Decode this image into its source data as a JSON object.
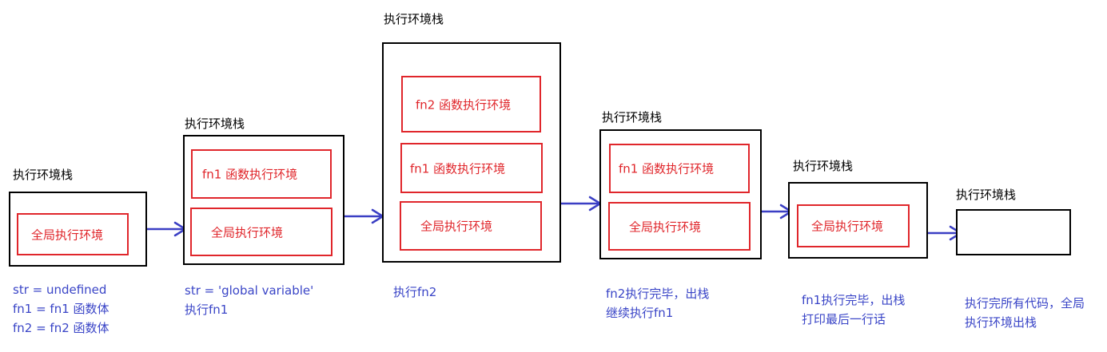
{
  "stages": [
    {
      "title": "执行环境栈",
      "contexts": [
        "全局执行环境"
      ],
      "notes": [
        "str = undefined",
        "fn1 = fn1 函数体",
        "fn2 = fn2 函数体"
      ]
    },
    {
      "title": "执行环境栈",
      "contexts": [
        "fn1 函数执行环境",
        "全局执行环境"
      ],
      "notes": [
        "str = 'global variable'",
        "执行fn1"
      ]
    },
    {
      "title": "执行环境栈",
      "contexts": [
        "fn2 函数执行环境",
        "fn1 函数执行环境",
        "全局执行环境"
      ],
      "notes": [
        "执行fn2"
      ]
    },
    {
      "title": "执行环境栈",
      "contexts": [
        "fn1 函数执行环境",
        "全局执行环境"
      ],
      "notes": [
        "fn2执行完毕，出栈",
        "继续执行fn1"
      ]
    },
    {
      "title": "执行环境栈",
      "contexts": [
        "全局执行环境"
      ],
      "notes": [
        "fn1执行完毕，出栈",
        "打印最后一行话"
      ]
    },
    {
      "title": "执行环境栈",
      "contexts": [],
      "notes": [
        "执行完所有代码，全局",
        "执行环境出栈"
      ]
    }
  ],
  "colors": {
    "stack_border": "#000000",
    "context_border": "#e0262b",
    "context_text": "#e0262b",
    "note_text": "#3a45c7",
    "arrow": "#3b3fc4"
  }
}
